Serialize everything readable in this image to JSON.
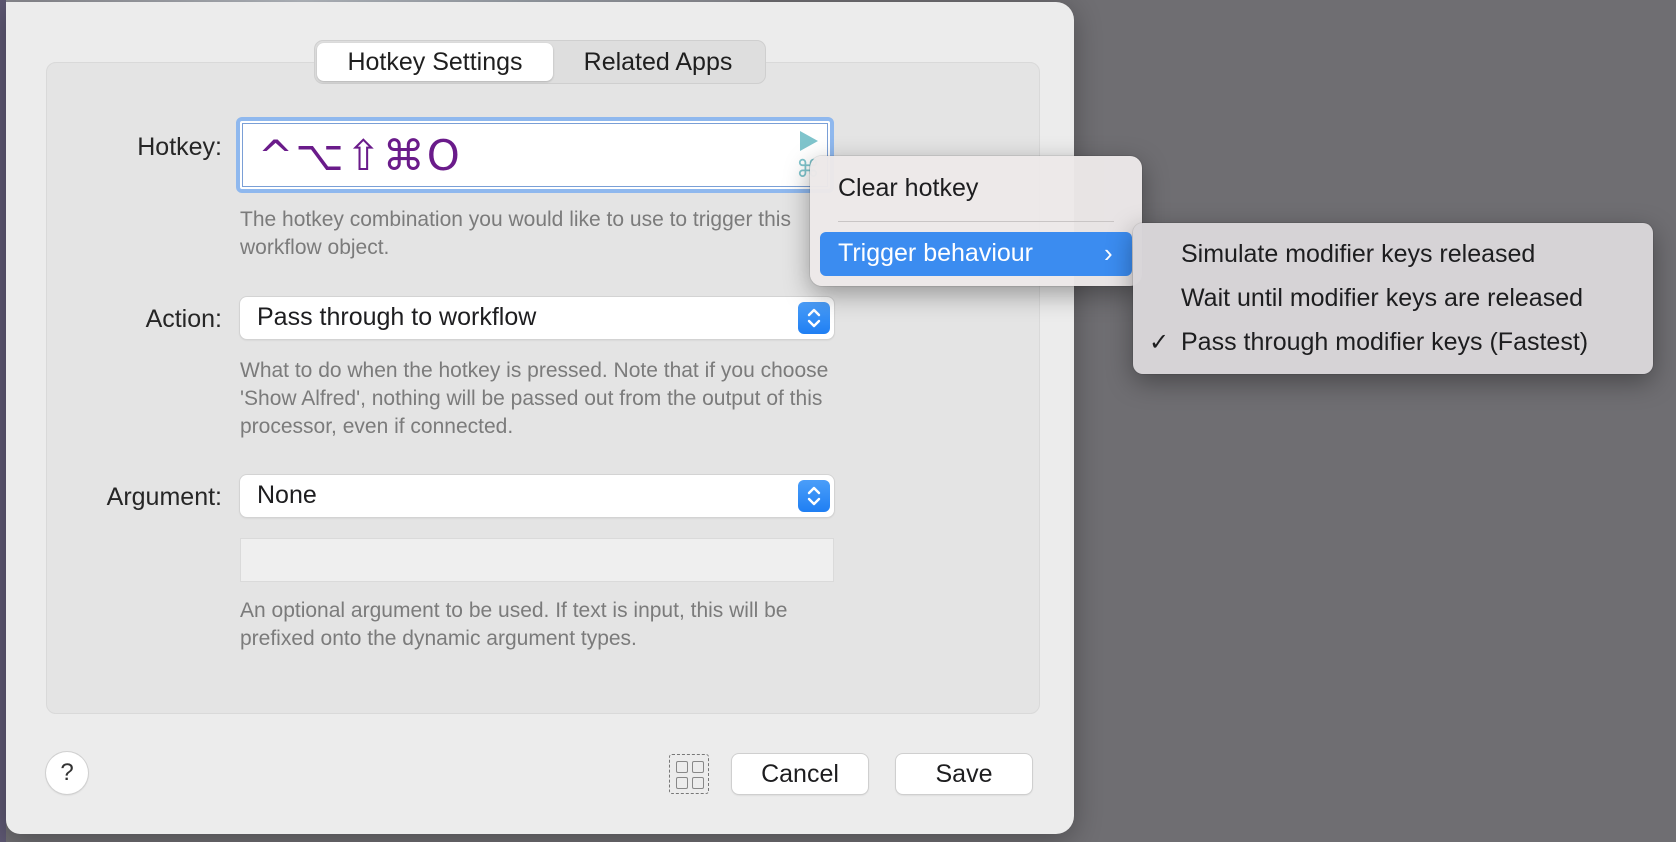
{
  "tabs": [
    {
      "label": "Hotkey Settings",
      "active": true
    },
    {
      "label": "Related Apps",
      "active": false
    }
  ],
  "hotkey": {
    "label": "Hotkey:",
    "value": "^⌥⇧⌘O",
    "help": "The hotkey combination you would like to use to trigger this workflow object."
  },
  "action": {
    "label": "Action:",
    "value": "Pass through to workflow",
    "help": "What to do when the hotkey is pressed. Note that if you choose 'Show Alfred', nothing will be passed out from the output of this processor, even if connected."
  },
  "argument": {
    "label": "Argument:",
    "value": "None",
    "text_value": "",
    "help": "An optional argument to be used. If text is input, this will be prefixed onto the dynamic argument types."
  },
  "footer": {
    "help_label": "?",
    "cancel_label": "Cancel",
    "save_label": "Save"
  },
  "context_menu": {
    "items": [
      {
        "label": "Clear hotkey"
      },
      {
        "label": "Trigger behaviour",
        "highlighted": true,
        "has_submenu": true,
        "chevron": "›"
      }
    ]
  },
  "submenu": {
    "checkmark": "✓",
    "items": [
      {
        "label": "Simulate modifier keys released",
        "checked": false
      },
      {
        "label": "Wait until modifier keys are released",
        "checked": false
      },
      {
        "label": "Pass through modifier keys (Fastest)",
        "checked": true
      }
    ]
  },
  "colors": {
    "accent": "#3b8cf0",
    "hotkey_text": "#6a1b8a",
    "hotkey_icons": "#7fc4cc"
  },
  "icons": [
    "play-icon",
    "command-icon",
    "stepper-icon",
    "grid-icon",
    "chevron-right-icon",
    "checkmark-icon"
  ]
}
